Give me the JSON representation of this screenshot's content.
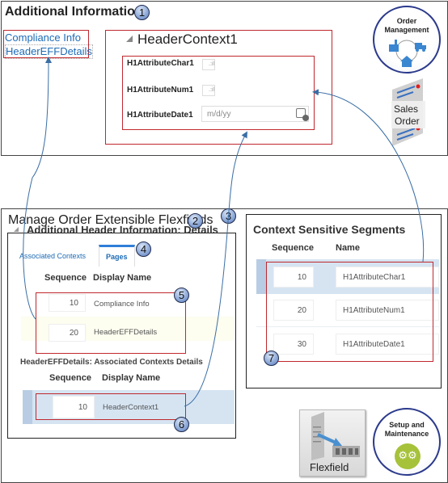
{
  "section1": {
    "title": "Additional Information",
    "badge": "1",
    "pages_links": [
      "Compliance Info",
      "HeaderEFFDetails"
    ],
    "context": {
      "title": "HeaderContext1",
      "collapse_icon": "triangle-down-icon",
      "fields": [
        {
          "label": "H1AttributeChar1",
          "type": "text",
          "value": ""
        },
        {
          "label": "H1AttributeNum1",
          "type": "number",
          "value": ""
        },
        {
          "label": "H1AttributeDate1",
          "type": "date",
          "placeholder": "m/d/yy",
          "icon": "calendar-icon"
        }
      ]
    },
    "order_mgmt_icon": {
      "line1": "Order",
      "line2": "Management"
    },
    "sales_order_icon": {
      "line1": "Sales",
      "line2": "Order"
    }
  },
  "section2": {
    "title": "Manage Order Extensible Flexfields",
    "badge": "2",
    "details_panel": {
      "title": "Additional Header Information: Details",
      "badge": "3",
      "tabs": [
        "Associated Contexts",
        "Pages"
      ],
      "active_tab": "Pages",
      "tab_badge": "4",
      "columns": [
        "Sequence",
        "Display Name"
      ],
      "rows": [
        {
          "sequence": "10",
          "name": "Compliance Info"
        },
        {
          "sequence": "20",
          "name": "HeaderEFFDetails"
        }
      ],
      "rows_badge": "5",
      "assoc_title": "HeaderEFFDetails: Associated Contexts Details",
      "assoc_columns": [
        "Sequence",
        "Display Name"
      ],
      "assoc_rows": [
        {
          "sequence": "10",
          "name": "HeaderContext1"
        }
      ],
      "assoc_badge": "6"
    },
    "segments_panel": {
      "title": "Context Sensitive Segments",
      "columns": [
        "Sequence",
        "Name"
      ],
      "rows": [
        {
          "sequence": "10",
          "name": "H1AttributeChar1"
        },
        {
          "sequence": "20",
          "name": "H1AttributeNum1"
        },
        {
          "sequence": "30",
          "name": "H1AttributeDate1"
        }
      ],
      "badge": "7"
    },
    "flexfield_icon": {
      "label": "Flexfield"
    },
    "setup_icon": {
      "line1": "Setup and",
      "line2": "Maintenance"
    }
  }
}
